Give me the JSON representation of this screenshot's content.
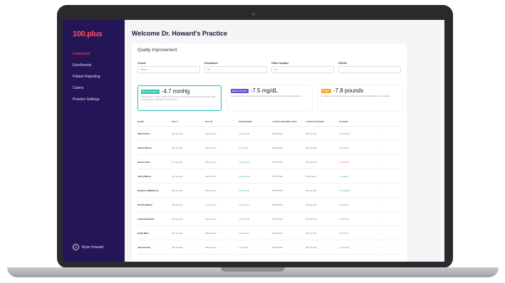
{
  "app": {
    "logo": "100.plus"
  },
  "sidebar": {
    "items": [
      {
        "label": "Dashboard",
        "active": true
      },
      {
        "label": "Enrollments",
        "active": false
      },
      {
        "label": "Patient Reporting",
        "active": false
      },
      {
        "label": "Claims",
        "active": false
      },
      {
        "label": "Practice Settings",
        "active": false
      }
    ],
    "user": {
      "initial": "R",
      "name": "Ryan Howard"
    }
  },
  "header": {
    "title": "Welcome Dr. Howard's Practice"
  },
  "quality": {
    "title": "Quality Improvement",
    "filters": [
      {
        "label": "Cohort",
        "value": "Select"
      },
      {
        "label": "Practitioner",
        "value": "All"
      },
      {
        "label": "Office location",
        "value": "All"
      },
      {
        "label": "ICD10s",
        "value": ""
      }
    ],
    "metrics": [
      {
        "tag": "Blood Pressure",
        "value": "-4.7 mmHg",
        "description": "Improvement in mean systolic blood pressure among patients with hypertension and prehypertension (elevated pressure) over",
        "color": "#27c3b3",
        "selected": true
      },
      {
        "tag": "Blood Glucose",
        "value": "-7.5 mg/dL",
        "description": "Improvement in mean fasting blood glucose among patients with hyperglycemia",
        "color": "#5b50d6",
        "selected": false
      },
      {
        "tag": "Weight",
        "value": "-7.8 pounds",
        "description": "Improvement in weight among overweight patients (prediabetic or overweight)",
        "color": "#f5a623",
        "selected": false
      }
    ]
  },
  "table": {
    "headers": [
      "NAME",
      "DAY 0",
      "DAY 30",
      "DIFFERENCE",
      "LATEST READING DATE",
      "LATEST READING",
      "CHANGE"
    ],
    "rows": [
      {
        "name": "Albert Perez",
        "day0": "231 pounds",
        "day30": "219 pounds",
        "diff": "-12 pounds",
        "date": "07/06/2021",
        "latest": "185 pounds",
        "change": "-13 pounds",
        "neg": false
      },
      {
        "name": "Arlene McCoy",
        "day0": "181 pounds",
        "day30": "180 pounds",
        "diff": "-1 pounds",
        "date": "07/05/2021",
        "latest": "162 pounds",
        "change": "-6 pounds",
        "neg": false
      },
      {
        "name": "Hansen Hon",
        "day0": "171 pounds",
        "day30": "182 pounds",
        "diff": "-11 pounds",
        "date": "07/13/2021",
        "latest": "167 pounds",
        "change": "+1 pounds",
        "neg": true
      },
      {
        "name": "Jenny Wilson",
        "day0": "149 pounds",
        "day30": "142 pounds",
        "diff": "-8.1 pounds",
        "date": "07/13/2021",
        "latest": "118 pounds",
        "change": "-3 pounds",
        "neg": false
      },
      {
        "name": "Cameron Williamson",
        "day0": "211 pounds",
        "day30": "204 pounds",
        "diff": "-12 pounds",
        "date": "07/13/2021",
        "latest": "205 pounds",
        "change": "-17 pounds",
        "neg": false
      },
      {
        "name": "Kristin Watson",
        "day0": "195 pounds",
        "day30": "171 pounds",
        "diff": "-11 pounds",
        "date": "07/03/2021",
        "latest": "188 pounds",
        "change": "-4 pounds",
        "neg": false
      },
      {
        "name": "Leslie Alexander",
        "day0": "149 pounds",
        "day30": "118 pounds",
        "diff": "-20 pounds",
        "date": "07/07/2021",
        "latest": "123 pounds",
        "change": "+4 pounds",
        "neg": true
      },
      {
        "name": "Floyd Miles",
        "day0": "227 pounds",
        "day30": "250 pounds",
        "diff": "-11 pounds",
        "date": "07/13/2021",
        "latest": "190 pounds",
        "change": "-6 pounds",
        "neg": false
      },
      {
        "name": "Jacob Jones",
        "day0": "195 pounds",
        "day30": "186 pounds",
        "diff": "-7 pounds",
        "date": "07/05/2021",
        "latest": "180 pounds",
        "change": "+9 pounds",
        "neg": true
      }
    ]
  }
}
